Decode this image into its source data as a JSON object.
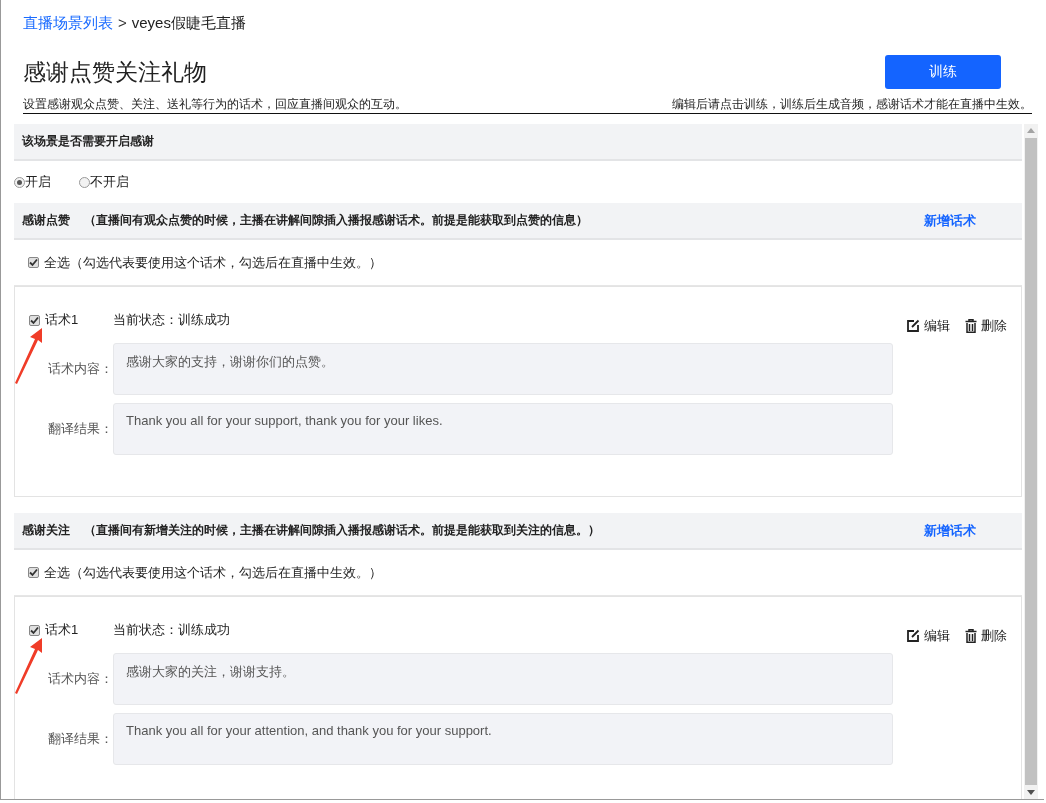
{
  "breadcrumb": {
    "link": "直播场景列表",
    "separator": ">",
    "current": "veyes假睫毛直播"
  },
  "title": "感谢点赞关注礼物",
  "train_button": "训练",
  "description": "设置感谢观众点赞、关注、送礼等行为的话术，回应直播间观众的互动。",
  "hint": "编辑后请点击训练，训练后生成音频，感谢话术才能在直播中生效。",
  "enable_section": {
    "title": "该场景是否需要开启感谢",
    "options": [
      {
        "label": "开启",
        "selected": true
      },
      {
        "label": "不开启",
        "selected": false
      }
    ]
  },
  "sections": [
    {
      "title": "感谢点赞",
      "note": "（直播间有观众点赞的时候，主播在讲解间隙插入播报感谢话术。前提是能获取到点赞的信息）",
      "add_link": "新增话术",
      "select_all": {
        "label": "全选（勾选代表要使用这个话术，勾选后在直播中生效。）",
        "checked": true
      },
      "scripts": [
        {
          "name": "话术1",
          "checked": true,
          "status": "当前状态：训练成功",
          "edit": "编辑",
          "delete": "删除",
          "content_label": "话术内容：",
          "content": "感谢大家的支持，谢谢你们的点赞。",
          "translation_label": "翻译结果：",
          "translation": "Thank you all for your support, thank you for your likes."
        }
      ]
    },
    {
      "title": "感谢关注",
      "note": "（直播间有新增关注的时候，主播在讲解间隙插入播报感谢话术。前提是能获取到关注的信息。）",
      "add_link": "新增话术",
      "select_all": {
        "label": "全选（勾选代表要使用这个话术，勾选后在直播中生效。）",
        "checked": true
      },
      "scripts": [
        {
          "name": "话术1",
          "checked": true,
          "status": "当前状态：训练成功",
          "edit": "编辑",
          "delete": "删除",
          "content_label": "话术内容：",
          "content": "感谢大家的关注，谢谢支持。",
          "translation_label": "翻译结果：",
          "translation": "Thank you all for your attention, and thank you for your support."
        }
      ]
    }
  ]
}
